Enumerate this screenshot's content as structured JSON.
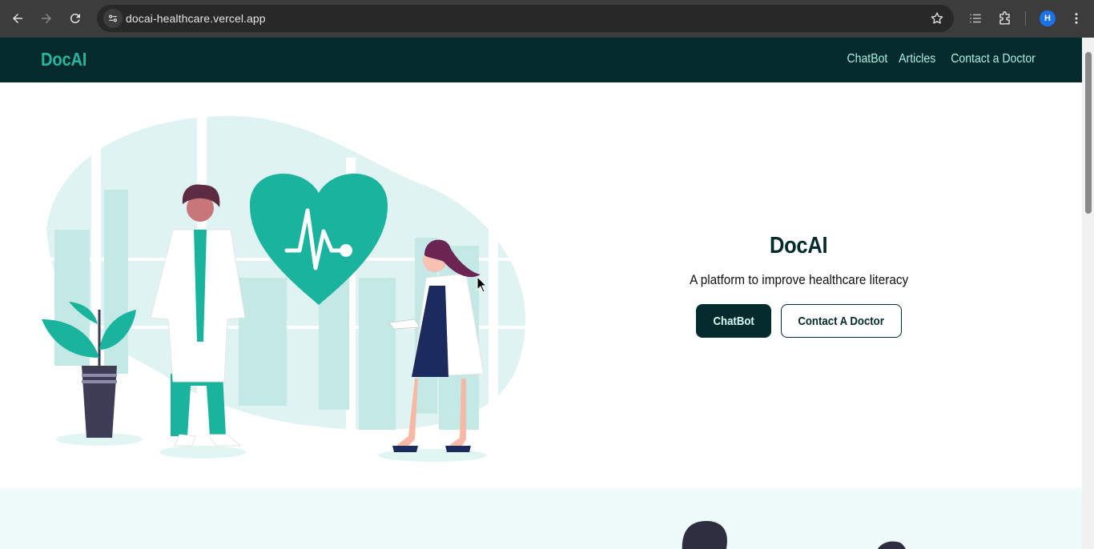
{
  "browser": {
    "url": "docai-healthcare.vercel.app",
    "profile_initial": "H",
    "icons": [
      "back-icon",
      "forward-icon",
      "reload-icon",
      "site-settings-icon",
      "bookmark-star-icon",
      "reading-list-icon",
      "extensions-icon",
      "menu-kebab-icon"
    ]
  },
  "site": {
    "brand": "DocAI",
    "nav": {
      "chatbot": "ChatBot",
      "articles": "Articles",
      "contact": "Contact a Doctor"
    },
    "hero": {
      "title": "DocAI",
      "subtitle": "A platform to improve healthcare literacy",
      "primary_button": "ChatBot",
      "secondary_button": "Contact A Doctor"
    }
  },
  "colors": {
    "nav_bg": "#032b2b",
    "brand": "#2ab3a0",
    "accent_teal": "#1ab39e",
    "section_bg": "#effbfa"
  }
}
